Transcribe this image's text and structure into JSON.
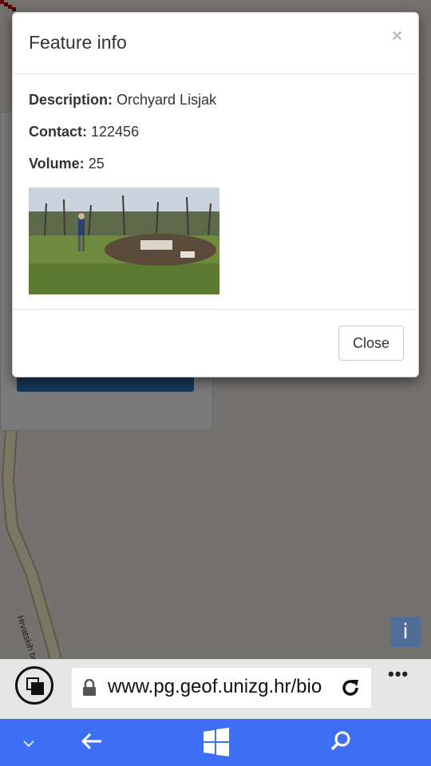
{
  "map": {
    "road_label": "Hrvatskih br",
    "info_button_label": "i"
  },
  "modal": {
    "title": "Feature info",
    "close_x": "×",
    "fields": {
      "description_label": "Description:",
      "description_value": "Orchyard Lisjak",
      "contact_label": "Contact:",
      "contact_value": "122456",
      "volume_label": "Volume:",
      "volume_value": "25"
    },
    "close_button_label": "Close"
  },
  "browser": {
    "url": "www.pg.geof.unizg.hr/bio",
    "more_label": "•••"
  },
  "colors": {
    "nav_bar": "#3f6ef6",
    "map_info_button": "#4f6d99"
  }
}
